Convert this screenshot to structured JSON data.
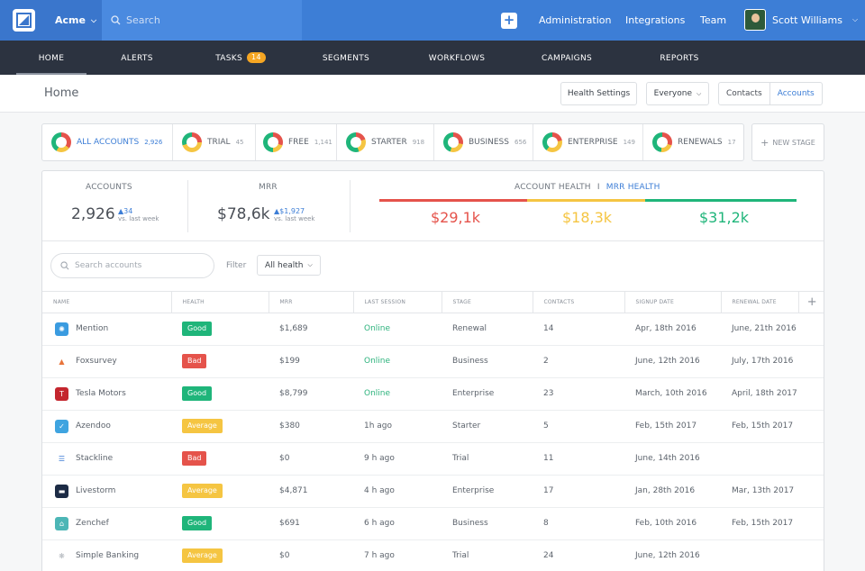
{
  "app": {
    "org": "Acme",
    "search_placeholder": "Search"
  },
  "topnav": {
    "links": [
      "Administration",
      "Integrations",
      "Team"
    ],
    "user": "Scott Williams"
  },
  "mainnav": {
    "items": [
      "HOME",
      "ALERTS",
      "TASKS",
      "SEGMENTS",
      "WORKFLOWS",
      "CAMPAIGNS",
      "REPORTS"
    ],
    "tasks_badge": "14"
  },
  "page": {
    "title": "Home",
    "health_settings": "Health Settings",
    "everyone": "Everyone",
    "contacts": "Contacts",
    "accounts": "Accounts"
  },
  "stages": [
    {
      "label": "ALL ACCOUNTS",
      "count": "2,926"
    },
    {
      "label": "TRIAL",
      "count": "45"
    },
    {
      "label": "FREE",
      "count": "1,141"
    },
    {
      "label": "STARTER",
      "count": "918"
    },
    {
      "label": "BUSINESS",
      "count": "656"
    },
    {
      "label": "ENTERPRISE",
      "count": "149"
    },
    {
      "label": "RENEWALS",
      "count": "17"
    }
  ],
  "new_stage": "NEW STAGE",
  "metrics": {
    "accounts_label": "ACCOUNTS",
    "accounts_value": "2,926",
    "accounts_delta": "34",
    "mrr_label": "MRR",
    "mrr_value": "$78,6k",
    "mrr_delta": "$1,927",
    "vs": "vs. last week",
    "health_label": "ACCOUNT HEALTH",
    "sep": "I",
    "mrr_health_label": "MRR HEALTH",
    "health_values": [
      "$29,1k",
      "$18,3k",
      "$31,2k"
    ]
  },
  "colors": {
    "bad": "#e5534b",
    "average": "#f5c542",
    "good": "#1fb57a",
    "accent": "#3d7ed6"
  },
  "toolbar": {
    "search_placeholder": "Search accounts",
    "filter_label": "Filter",
    "filter_value": "All health"
  },
  "table": {
    "headers": [
      "NAME",
      "HEALTH",
      "MRR",
      "LAST SESSION",
      "STAGE",
      "CONTACTS",
      "SIGNUP DATE",
      "RENEWAL DATE",
      "+"
    ],
    "rows": [
      {
        "name": "Mention",
        "health": "Good",
        "mrr": "$1,689",
        "session": "Online",
        "stage": "Renewal",
        "contacts": "14",
        "signup": "Apr, 18th 2016",
        "renewal": "June, 21th 2016",
        "icon": "mention-icon"
      },
      {
        "name": "Foxsurvey",
        "health": "Bad",
        "mrr": "$199",
        "session": "Online",
        "stage": "Business",
        "contacts": "2",
        "signup": "June, 12th 2016",
        "renewal": "July, 17th 2016",
        "icon": "foxsurvey-icon"
      },
      {
        "name": "Tesla Motors",
        "health": "Good",
        "mrr": "$8,799",
        "session": "Online",
        "stage": "Enterprise",
        "contacts": "23",
        "signup": "March, 10th 2016",
        "renewal": "April, 18th 2017",
        "icon": "tesla-icon"
      },
      {
        "name": "Azendoo",
        "health": "Average",
        "mrr": "$380",
        "session": "1h ago",
        "stage": "Starter",
        "contacts": "5",
        "signup": "Feb, 15th 2017",
        "renewal": "Feb, 15th 2017",
        "icon": "azendoo-icon"
      },
      {
        "name": "Stackline",
        "health": "Bad",
        "mrr": "$0",
        "session": "9 h ago",
        "stage": "Trial",
        "contacts": "11",
        "signup": "June, 14th 2016",
        "renewal": "",
        "icon": "stackline-icon"
      },
      {
        "name": "Livestorm",
        "health": "Average",
        "mrr": "$4,871",
        "session": "4 h ago",
        "stage": "Enterprise",
        "contacts": "17",
        "signup": "Jan, 28th 2016",
        "renewal": "Mar, 13th 2017",
        "icon": "livestorm-icon"
      },
      {
        "name": "Zenchef",
        "health": "Good",
        "mrr": "$691",
        "session": "6 h ago",
        "stage": "Business",
        "contacts": "8",
        "signup": "Feb, 10th 2016",
        "renewal": "Feb, 15th 2017",
        "icon": "zenchef-icon"
      },
      {
        "name": "Simple Banking",
        "health": "Average",
        "mrr": "$0",
        "session": "7 h ago",
        "stage": "Trial",
        "contacts": "24",
        "signup": "June, 12th 2016",
        "renewal": "",
        "icon": "simple-banking-icon"
      }
    ]
  }
}
